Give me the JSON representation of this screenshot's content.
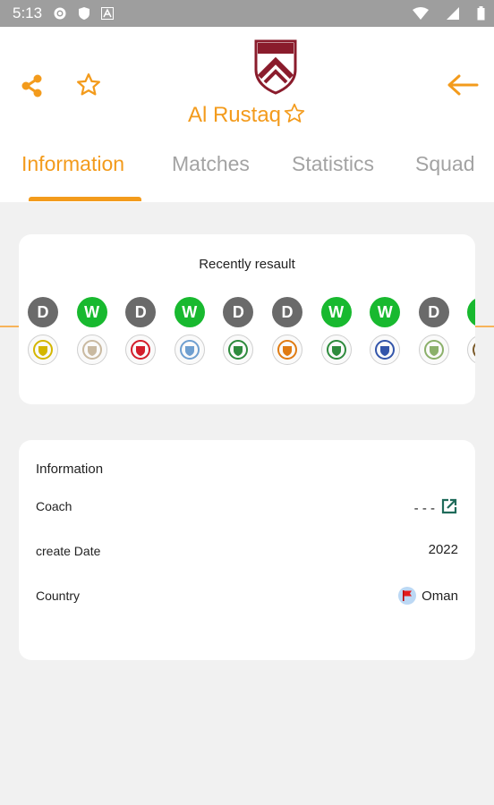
{
  "status_bar": {
    "time": "5:13"
  },
  "header": {
    "team_name": "Al Rustaq",
    "tabs": [
      {
        "label": "Information",
        "active": true
      },
      {
        "label": "Matches",
        "active": false
      },
      {
        "label": "Statistics",
        "active": false
      },
      {
        "label": "Squad",
        "active": false
      }
    ]
  },
  "colors": {
    "accent": "#f39b1c",
    "win": "#18b92f",
    "draw": "#6a6a6a",
    "logo": "#8a1c2c"
  },
  "recent": {
    "title": "Recently resault",
    "results": [
      {
        "result": "D",
        "opponent_logo": "club-crest-icon"
      },
      {
        "result": "W",
        "opponent_logo": "club-crest-icon"
      },
      {
        "result": "D",
        "opponent_logo": "club-crest-icon"
      },
      {
        "result": "W",
        "opponent_logo": "club-crest-icon"
      },
      {
        "result": "D",
        "opponent_logo": "club-crest-icon"
      },
      {
        "result": "D",
        "opponent_logo": "club-crest-icon"
      },
      {
        "result": "W",
        "opponent_logo": "club-crest-icon"
      },
      {
        "result": "W",
        "opponent_logo": "club-crest-icon"
      },
      {
        "result": "D",
        "opponent_logo": "club-crest-icon"
      },
      {
        "result": "W",
        "opponent_logo": "club-crest-icon"
      }
    ]
  },
  "info": {
    "title": "Information",
    "coach_label": "Coach",
    "coach_value": "- - -",
    "create_date_label": "create Date",
    "create_date_value": "2022",
    "country_label": "Country",
    "country_value": "Oman"
  }
}
